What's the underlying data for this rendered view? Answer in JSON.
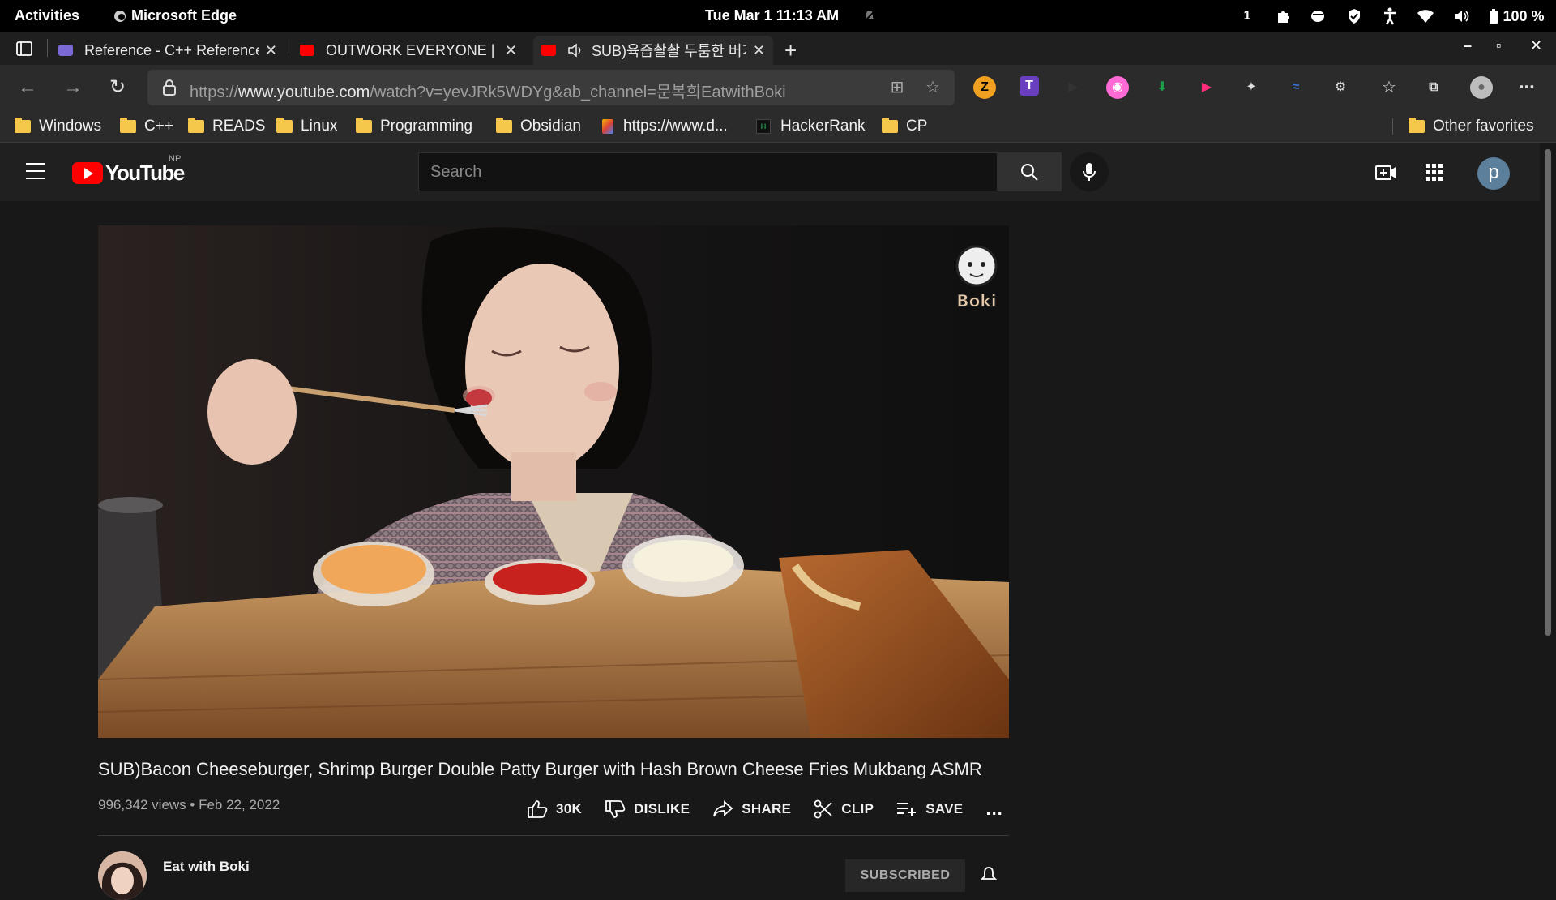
{
  "system": {
    "activities": "Activities",
    "app_name": "Microsoft Edge",
    "clock": "Tue Mar 1  11:13 AM",
    "workspace": "1",
    "battery": "100 %"
  },
  "tabs": [
    {
      "title": "Reference - C++ Reference",
      "favicon_color": "#7b6ad6"
    },
    {
      "title": "OUTWORK EVERYONE | Y",
      "favicon_color": "#ff0000"
    },
    {
      "title": "SUB)육즙촬촬 두툼한 버거",
      "favicon_color": "#ff0000",
      "active": true
    }
  ],
  "new_tab_label": "+",
  "address": {
    "url_prefix": "https://",
    "url_host": "www.youtube.com",
    "url_path": "/watch?v=yevJRk5WDYg&ab_channel=문복희EatwithBoki"
  },
  "favorites": [
    {
      "label": "Windows",
      "type": "folder"
    },
    {
      "label": "C++",
      "type": "folder"
    },
    {
      "label": "READS",
      "type": "folder"
    },
    {
      "label": "Linux",
      "type": "folder"
    },
    {
      "label": "Programming",
      "type": "folder"
    },
    {
      "label": "Obsidian",
      "type": "folder"
    },
    {
      "label": "https://www.d...",
      "type": "link"
    },
    {
      "label": "HackerRank",
      "type": "link"
    },
    {
      "label": "CP",
      "type": "folder"
    }
  ],
  "other_favorites": "Other favorites",
  "youtube": {
    "logo_text": "YouTube",
    "country_code": "NP",
    "search_placeholder": "Search",
    "avatar_letter": "p"
  },
  "video": {
    "watermark": "Boki",
    "title": "SUB)Bacon Cheeseburger, Shrimp Burger Double Patty Burger with Hash Brown Cheese Fries Mukbang ASMR",
    "views_date": "996,342 views • Feb 22, 2022",
    "likes": "30K",
    "dislike": "DISLIKE",
    "share": "SHARE",
    "clip": "CLIP",
    "save": "SAVE",
    "more": "..."
  },
  "channel": {
    "name": "Eat with Boki",
    "subscribe_label": "SUBSCRIBED"
  }
}
